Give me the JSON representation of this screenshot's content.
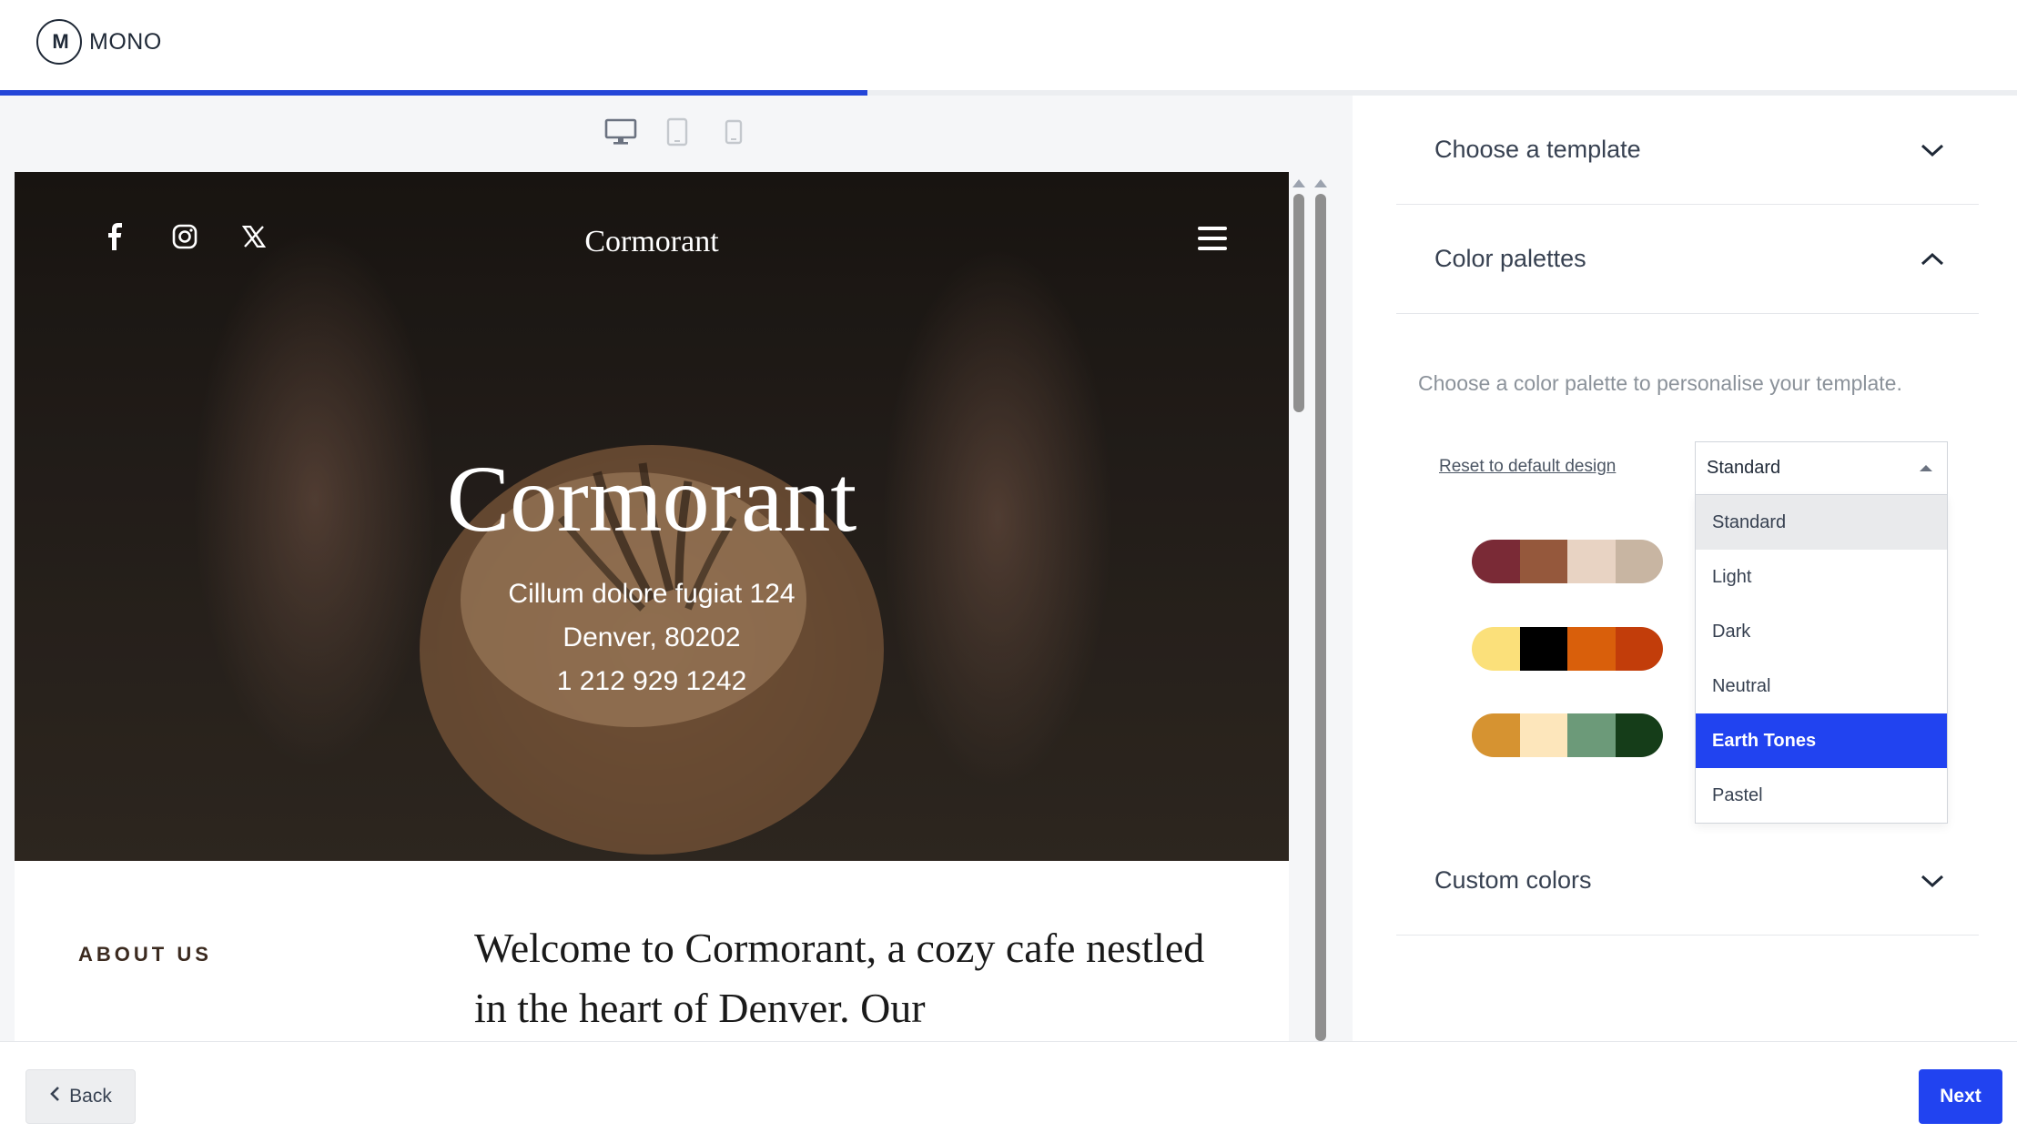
{
  "header": {
    "logo_mark": "M",
    "logo_text": "MONO",
    "progress_fraction": 0.43
  },
  "preview": {
    "devices": [
      "desktop-icon",
      "tablet-icon",
      "mobile-icon"
    ],
    "site": {
      "brand": "Cormorant",
      "social": [
        "facebook-icon",
        "instagram-icon",
        "x-icon"
      ],
      "hero_title": "Cormorant",
      "address_line1": "Cillum dolore fugiat 124",
      "address_line2": "Denver, 80202",
      "phone": "1 212 929 1242",
      "about_label": "ABOUT US",
      "about_text": "Welcome to Cormorant, a cozy cafe nestled in the heart of Denver. Our"
    }
  },
  "panel": {
    "sections": {
      "template": "Choose a template",
      "palettes": "Color palettes",
      "custom": "Custom colors"
    },
    "palette_description": "Choose a color palette to personalise your template.",
    "reset_label": "Reset to default design",
    "select_value": "Standard",
    "options": [
      "Standard",
      "Light",
      "Dark",
      "Neutral",
      "Earth Tones",
      "Pastel"
    ],
    "highlighted_option": "Earth Tones",
    "swatches": [
      [
        "#7a2a36",
        "#95583c",
        "#e8d3c3",
        "#c8b5a2"
      ],
      [
        "#fbe07a",
        "#000000",
        "#d95f0b",
        "#c23d0a"
      ],
      [
        "#d69331",
        "#fde6bb",
        "#6c9a79",
        "#153d19"
      ]
    ],
    "accent_color": "#2143f0"
  },
  "footer": {
    "back_label": "Back",
    "next_label": "Next"
  }
}
